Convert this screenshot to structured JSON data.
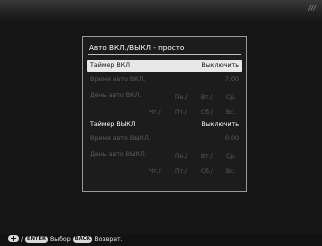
{
  "status_bar": {
    "logo_text": "///"
  },
  "dialog": {
    "title": "Авто ВКЛ./ВЫКЛ - просто",
    "on_timer": {
      "label": "Таймер ВКЛ",
      "value": "Выключить"
    },
    "on_time": {
      "label": "Время авто ВКЛ.",
      "value": "7:00"
    },
    "on_days": {
      "label": "День авто ВКЛ.",
      "days": [
        "Пн./",
        "Вт./",
        "Ср.",
        "Чт./",
        "Пт./",
        "Сб./",
        "Вс."
      ]
    },
    "off_timer": {
      "label": "Таймер ВЫКЛ",
      "value": "Выключить"
    },
    "off_time": {
      "label": "Время авто ВЫКЛ.",
      "value": "0:00"
    },
    "off_days": {
      "label": "День авто ВЫКЛ.",
      "days": [
        "Пн./",
        "Вт./",
        "Ср.",
        "Чт./",
        "Пт./",
        "Сб./",
        "Вс."
      ]
    }
  },
  "hint_bar": {
    "separator": "/",
    "enter_key": "ENTER",
    "select_label": "Выбор",
    "back_key": "BACK",
    "back_label": "Возврат."
  }
}
